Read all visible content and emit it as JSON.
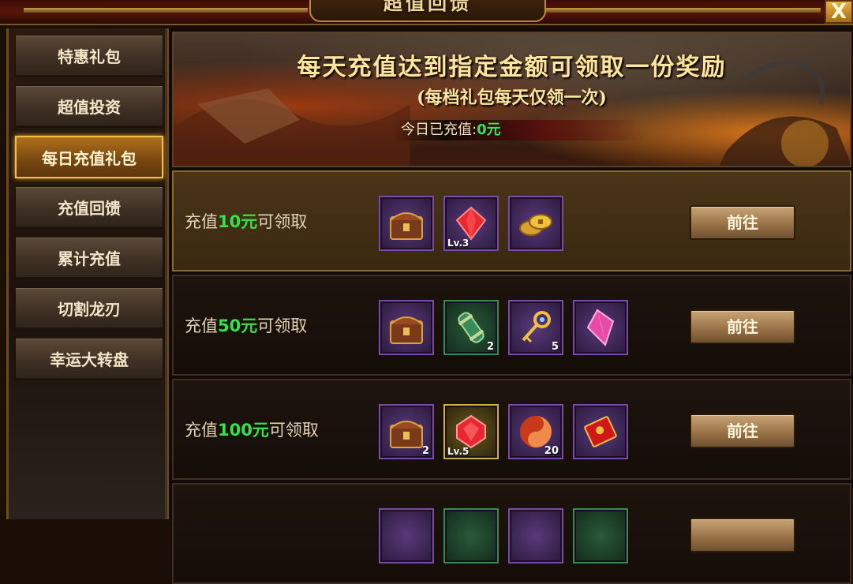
{
  "window": {
    "title": "超值回馈",
    "close_label": "X"
  },
  "sidebar": {
    "items": [
      {
        "label": "特惠礼包",
        "active": false
      },
      {
        "label": "超值投资",
        "active": false
      },
      {
        "label": "每日充值礼包",
        "active": true
      },
      {
        "label": "充值回馈",
        "active": false
      },
      {
        "label": "累计充值",
        "active": false
      },
      {
        "label": "切割龙刃",
        "active": false
      },
      {
        "label": "幸运大转盘",
        "active": false
      }
    ]
  },
  "banner": {
    "line1": "每天充值达到指定金额可领取一份奖励",
    "line2": "(每档礼包每天仅领一次)",
    "today_label": "今日已充值:",
    "today_value": "0元"
  },
  "tiers": [
    {
      "prefix": "充值",
      "amount": "10元",
      "suffix": "可领取",
      "button": "前往",
      "items": [
        {
          "icon": "treasure-chest-icon",
          "count": "",
          "level": ""
        },
        {
          "icon": "red-gem-icon",
          "count": "",
          "level": "Lv.3"
        },
        {
          "icon": "gold-coins-icon",
          "count": "",
          "level": ""
        }
      ]
    },
    {
      "prefix": "充值",
      "amount": "50元",
      "suffix": "可领取",
      "button": "前往",
      "items": [
        {
          "icon": "treasure-chest-icon",
          "count": "",
          "level": ""
        },
        {
          "icon": "scroll-icon",
          "count": "2",
          "level": ""
        },
        {
          "icon": "golden-key-icon",
          "count": "5",
          "level": ""
        },
        {
          "icon": "pink-crystal-icon",
          "count": "",
          "level": ""
        }
      ]
    },
    {
      "prefix": "充值",
      "amount": "100元",
      "suffix": "可领取",
      "button": "前往",
      "items": [
        {
          "icon": "treasure-chest-icon",
          "count": "2",
          "level": ""
        },
        {
          "icon": "red-gem-icon",
          "count": "",
          "level": "Lv.5"
        },
        {
          "icon": "flame-orb-icon",
          "count": "20",
          "level": ""
        },
        {
          "icon": "red-envelope-icon",
          "count": "",
          "level": ""
        }
      ]
    }
  ],
  "colors": {
    "accent_green": "#35e24a",
    "active_tab": "#b0701c",
    "gold_border": "#f2c04a"
  }
}
